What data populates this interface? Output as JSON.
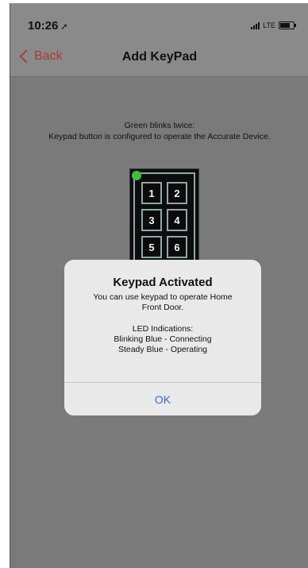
{
  "status_bar": {
    "time": "10:26",
    "location_icon": "location-arrow-icon",
    "network": "LTE",
    "battery_icon": "battery-icon"
  },
  "nav": {
    "back_label": "Back",
    "title": "Add KeyPad"
  },
  "instruction": {
    "line1": "Green blinks twice:",
    "line2": "Keypad button is configured to operate the Accurate Device."
  },
  "keypad": {
    "keys": [
      "1",
      "2",
      "3",
      "4",
      "5",
      "6"
    ],
    "led_color": "#3fbf3f"
  },
  "alert": {
    "title": "Keypad Activated",
    "message_line1": "You can use keypad to operate Home",
    "message_line2": "Front Door.",
    "led_heading": "LED Indications:",
    "led_line1": "Blinking Blue - Connecting",
    "led_line2": "Steady Blue - Operating",
    "ok_label": "OK"
  },
  "colors": {
    "accent_back": "#b03a3a",
    "alert_button": "#2f6fd0"
  }
}
